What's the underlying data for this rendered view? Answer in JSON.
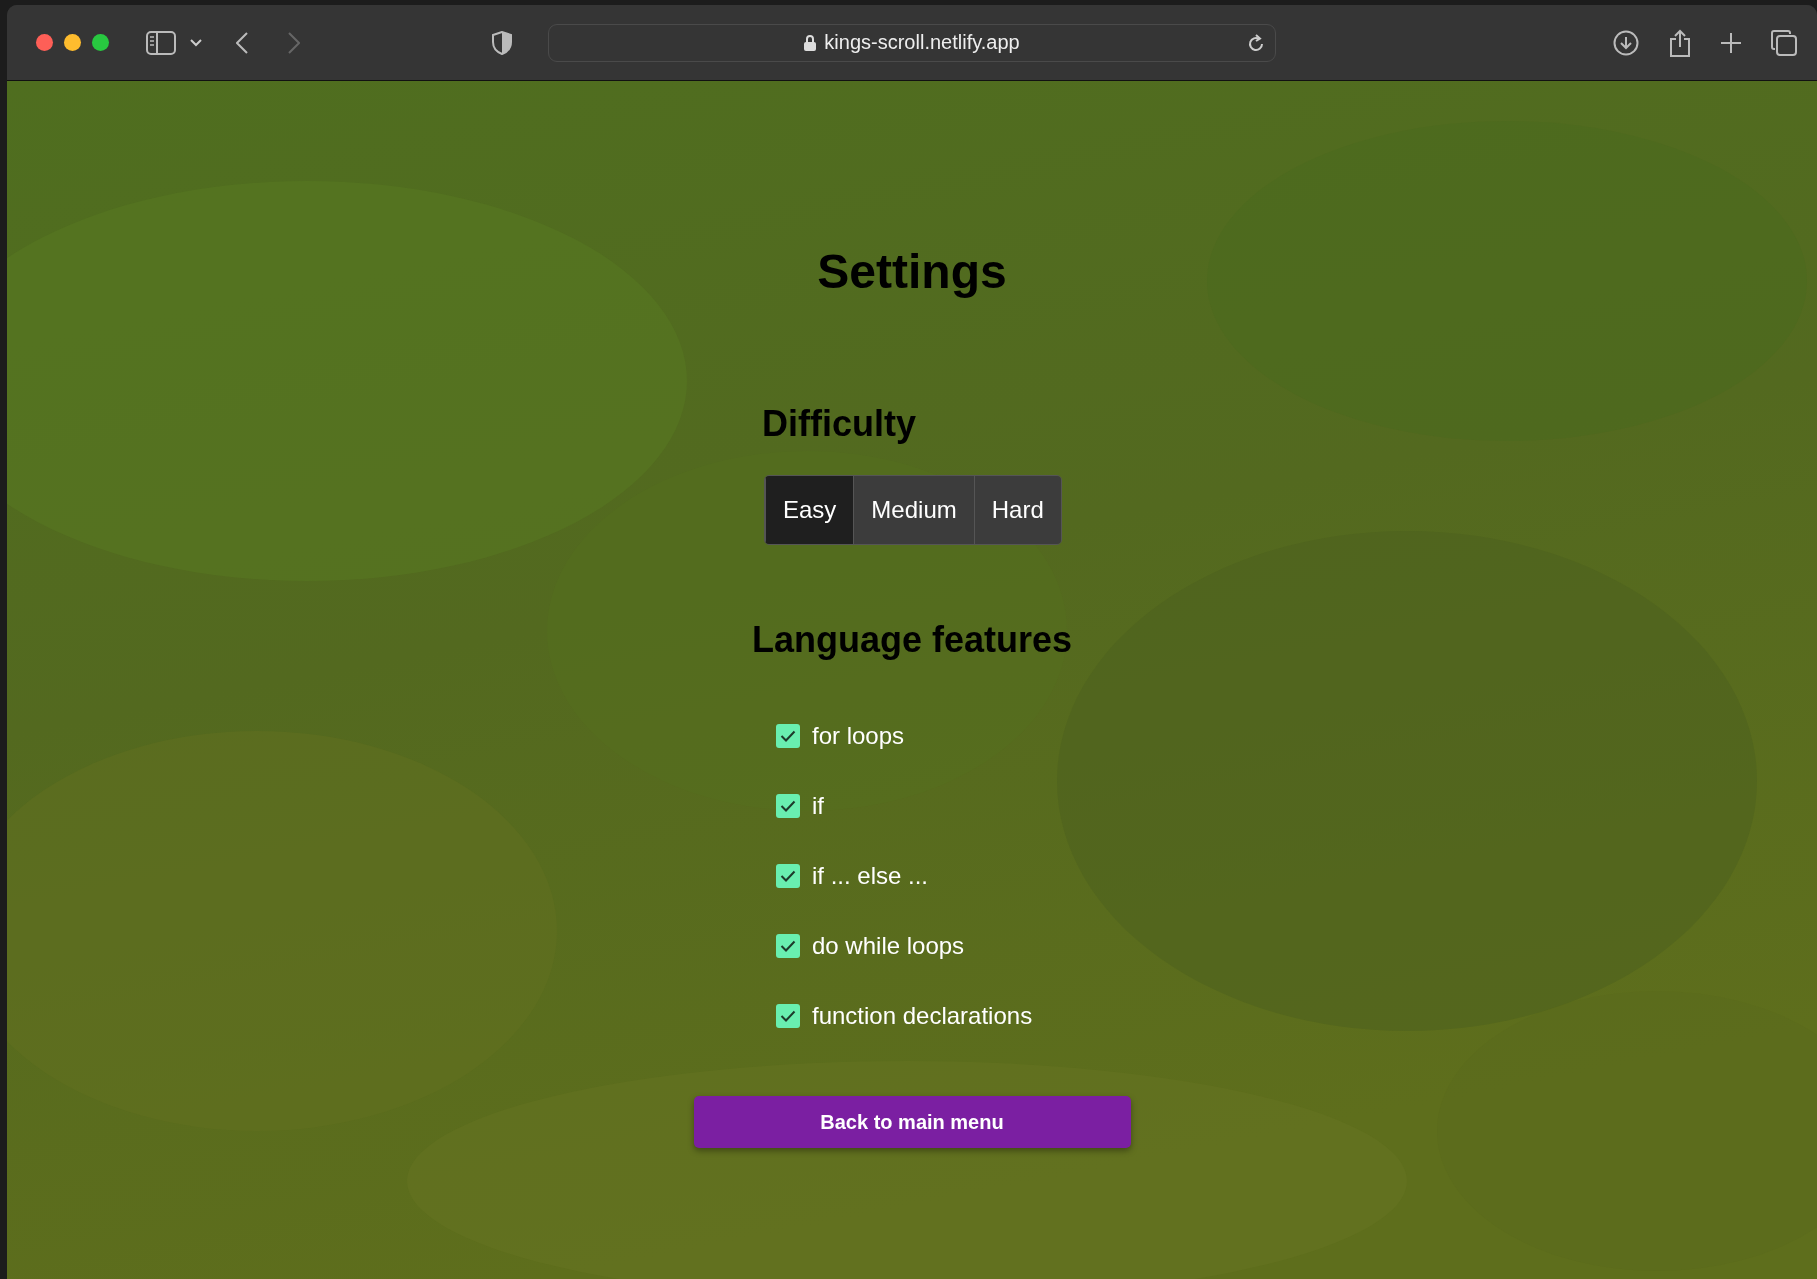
{
  "browser": {
    "url": "kings-scroll.netlify.app"
  },
  "title": "Settings",
  "difficulty": {
    "heading": "Difficulty",
    "options": [
      {
        "label": "Easy",
        "selected": true
      },
      {
        "label": "Medium",
        "selected": false
      },
      {
        "label": "Hard",
        "selected": false
      }
    ]
  },
  "features": {
    "heading": "Language features",
    "items": [
      {
        "label": "for loops",
        "checked": true
      },
      {
        "label": "if",
        "checked": true
      },
      {
        "label": "if ... else ...",
        "checked": true
      },
      {
        "label": "do while loops",
        "checked": true
      },
      {
        "label": "function declarations",
        "checked": true
      }
    ]
  },
  "back_button": "Back to main menu"
}
